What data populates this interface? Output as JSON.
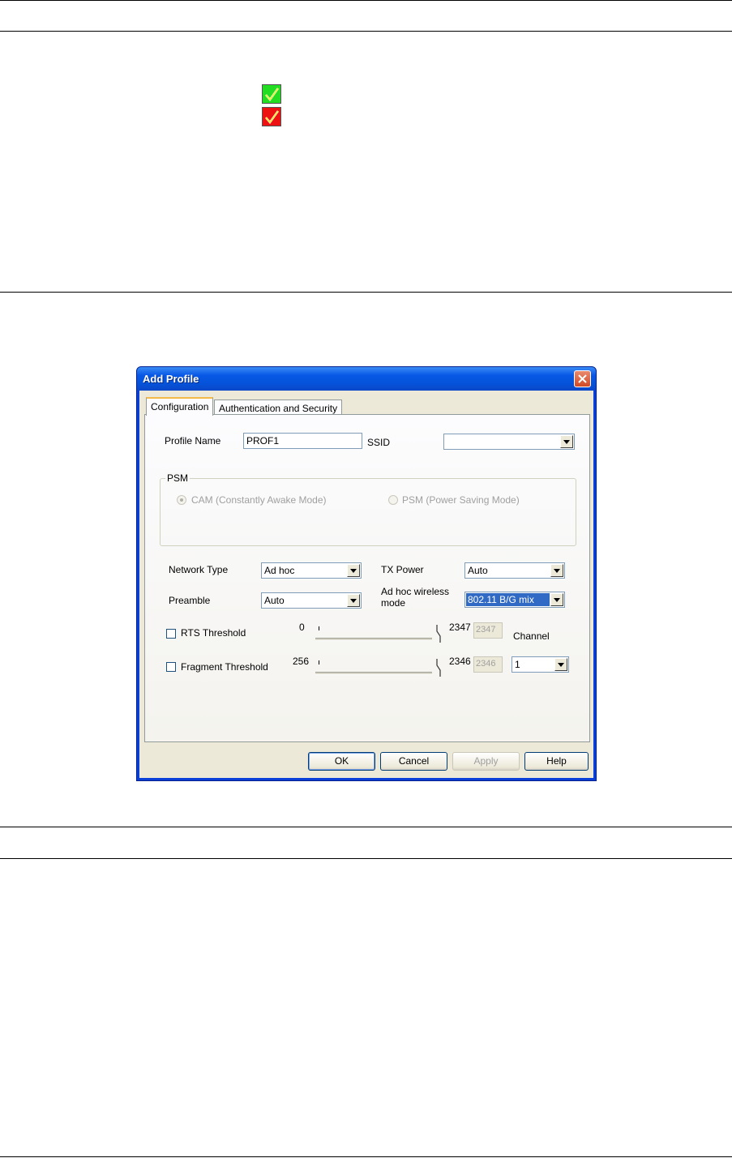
{
  "status_icons": [
    {
      "name": "green-check-icon",
      "color": "#22dd22"
    },
    {
      "name": "red-check-icon",
      "color": "#ee1111"
    }
  ],
  "dialog": {
    "title": "Add Profile",
    "tabs": [
      {
        "label": "Configuration",
        "active": true
      },
      {
        "label": "Authentication and Security",
        "active": false
      }
    ],
    "profile_name": {
      "label": "Profile Name",
      "value": "PROF1"
    },
    "ssid": {
      "label": "SSID",
      "value": ""
    },
    "psm": {
      "group_label": "PSM",
      "options": [
        {
          "label": "CAM (Constantly Awake Mode)",
          "selected": true,
          "enabled": false
        },
        {
          "label": "PSM (Power Saving Mode)",
          "selected": false,
          "enabled": false
        }
      ]
    },
    "network_type": {
      "label": "Network Type",
      "value": "Ad hoc"
    },
    "tx_power": {
      "label": "TX Power",
      "value": "Auto"
    },
    "preamble": {
      "label": "Preamble",
      "value": "Auto"
    },
    "adhoc_mode": {
      "label_line1": "Ad hoc wireless",
      "label_line2": "mode",
      "value": "802.11 B/G mix"
    },
    "rts": {
      "label": "RTS Threshold",
      "checked": false,
      "min": "0",
      "max": "2347",
      "value": "2347"
    },
    "fragment": {
      "label": "Fragment Threshold",
      "checked": false,
      "min": "256",
      "max": "2346",
      "value": "2346"
    },
    "channel": {
      "label": "Channel",
      "value": "1"
    },
    "buttons": {
      "ok": "OK",
      "cancel": "Cancel",
      "apply": "Apply",
      "help": "Help"
    }
  }
}
